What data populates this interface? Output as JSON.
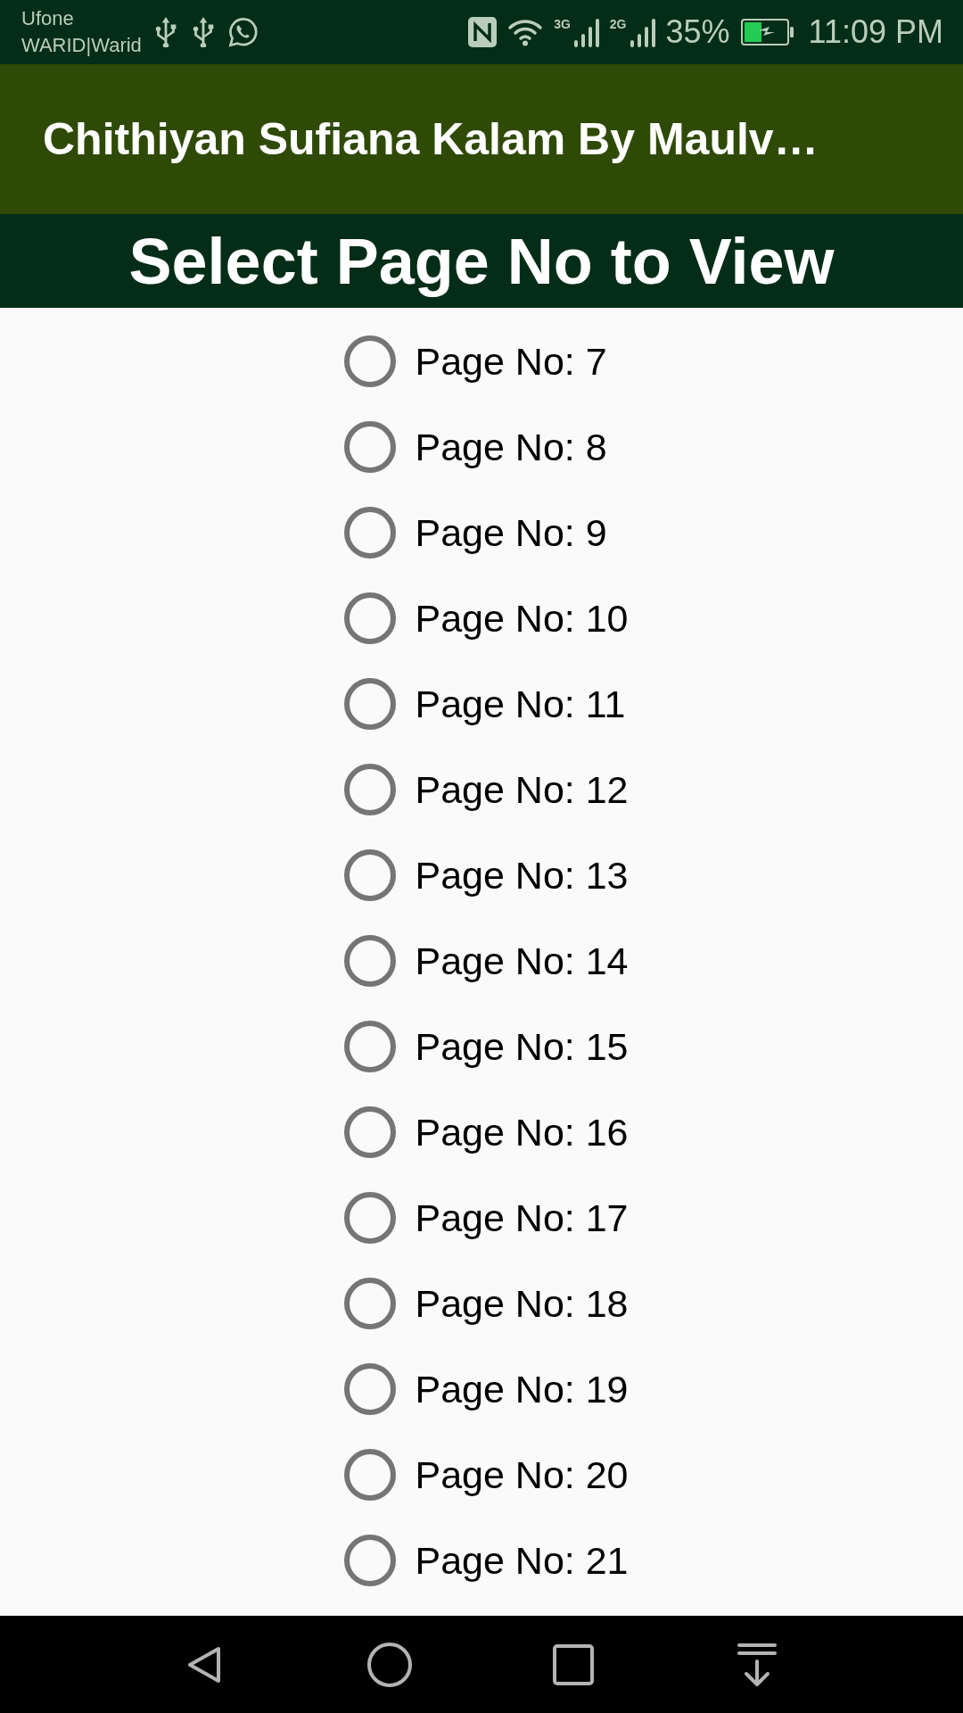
{
  "status_bar": {
    "carriers": [
      "Ufone",
      "WARID|Warid"
    ],
    "networks": [
      {
        "label": "3G"
      },
      {
        "label": "2G"
      }
    ],
    "battery": "35%",
    "time": "11:09 PM"
  },
  "app_bar": {
    "title": "Chithiyan Sufiana Kalam By Maulv…"
  },
  "header": {
    "title": "Select Page No to View"
  },
  "pages": [
    {
      "label": "Page No: 7",
      "selected": false
    },
    {
      "label": "Page No: 8",
      "selected": false
    },
    {
      "label": "Page No: 9",
      "selected": false
    },
    {
      "label": "Page No: 10",
      "selected": false
    },
    {
      "label": "Page No: 11",
      "selected": false
    },
    {
      "label": "Page No: 12",
      "selected": false
    },
    {
      "label": "Page No: 13",
      "selected": false
    },
    {
      "label": "Page No: 14",
      "selected": false
    },
    {
      "label": "Page No: 15",
      "selected": false
    },
    {
      "label": "Page No: 16",
      "selected": false
    },
    {
      "label": "Page No: 17",
      "selected": false
    },
    {
      "label": "Page No: 18",
      "selected": false
    },
    {
      "label": "Page No: 19",
      "selected": false
    },
    {
      "label": "Page No: 20",
      "selected": false
    },
    {
      "label": "Page No: 21",
      "selected": false
    }
  ]
}
